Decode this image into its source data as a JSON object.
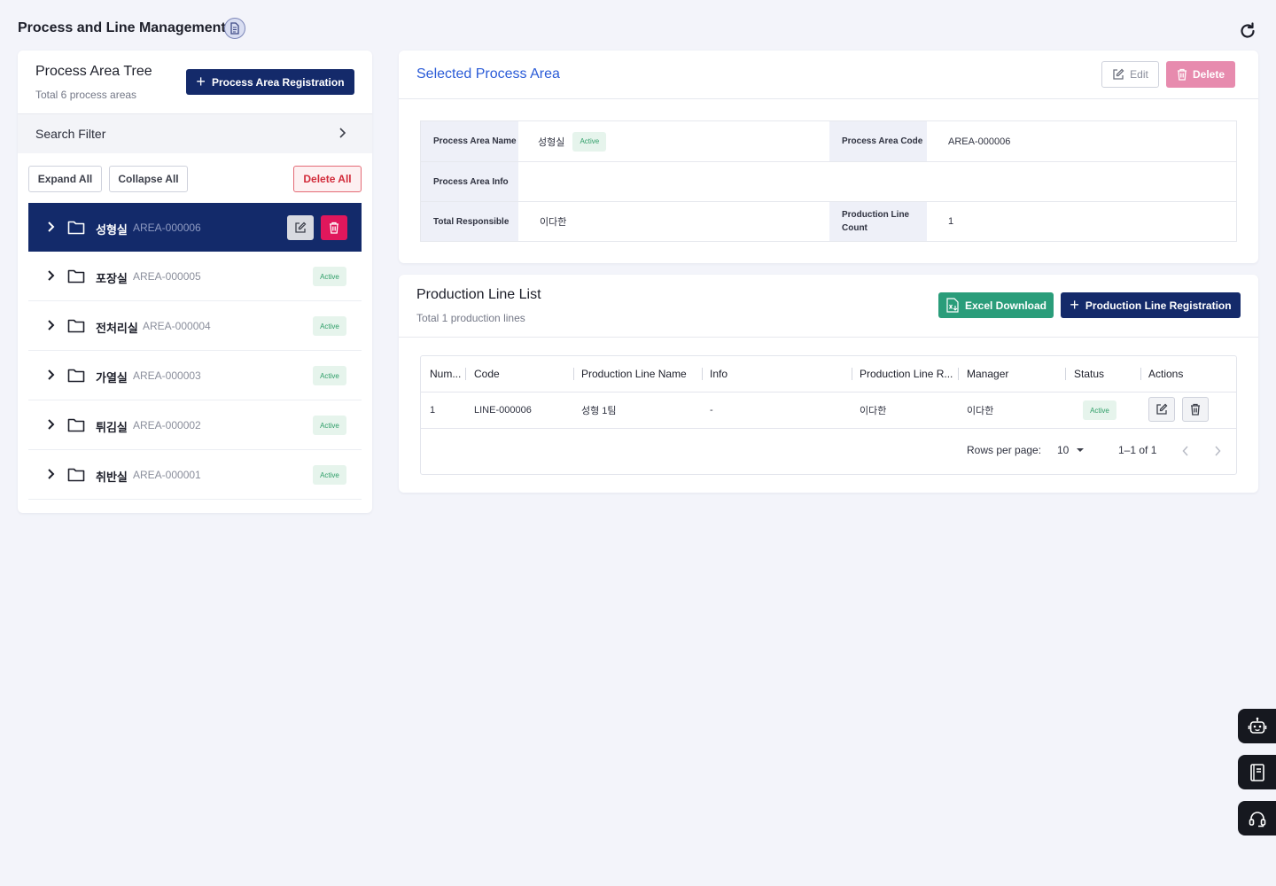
{
  "page": {
    "title": "Process and Line Management",
    "title_icon": "document-icon",
    "refresh_icon": "refresh-icon"
  },
  "tree": {
    "title": "Process Area Tree",
    "subtitle": "Total 6 process areas",
    "register_label": "Process Area Registration",
    "search_filter_label": "Search Filter",
    "expand_all": "Expand All",
    "collapse_all": "Collapse All",
    "delete_all": "Delete All",
    "items": [
      {
        "name": "성형실",
        "code": "AREA-000006",
        "status": "",
        "selected": true
      },
      {
        "name": "포장실",
        "code": "AREA-000005",
        "status": "Active",
        "selected": false
      },
      {
        "name": "전처리실",
        "code": "AREA-000004",
        "status": "Active",
        "selected": false
      },
      {
        "name": "가열실",
        "code": "AREA-000003",
        "status": "Active",
        "selected": false
      },
      {
        "name": "튀김실",
        "code": "AREA-000002",
        "status": "Active",
        "selected": false
      },
      {
        "name": "취반실",
        "code": "AREA-000001",
        "status": "Active",
        "selected": false
      }
    ]
  },
  "detail": {
    "title": "Selected Process Area",
    "edit_label": "Edit",
    "delete_label": "Delete",
    "fields": {
      "name_label": "Process Area Name",
      "name_value": "성형실",
      "name_status": "Active",
      "code_label": "Process Area Code",
      "code_value": "AREA-000006",
      "info_label": "Process Area Info",
      "info_value": "",
      "responsible_label": "Total Responsible",
      "responsible_value": "이다한",
      "line_count_label": "Production Line Count",
      "line_count_value": "1"
    }
  },
  "lines": {
    "title": "Production Line List",
    "subtitle": "Total 1 production lines",
    "excel_label": "Excel Download",
    "register_label": "Production Line Registration",
    "columns": [
      "Num...",
      "Code",
      "Production Line Name",
      "Info",
      "Production Line R...",
      "Manager",
      "Status",
      "Actions"
    ],
    "rows": [
      {
        "num": "1",
        "code": "LINE-000006",
        "name": "성형 1팀",
        "info": "-",
        "responsible": "이다한",
        "manager": "이다한",
        "status": "Active"
      }
    ],
    "pagination": {
      "rows_per_page_label": "Rows per page:",
      "rows_per_page": "10",
      "range": "1–1 of 1"
    }
  },
  "floating": [
    "robot-icon",
    "book-icon",
    "headset-icon"
  ],
  "colors": {
    "primary": "#142a6a",
    "accent_blue": "#2a5bd7",
    "danger": "#e0175c",
    "excel_green": "#2a9d7a",
    "active_badge": "#2f9e68"
  }
}
